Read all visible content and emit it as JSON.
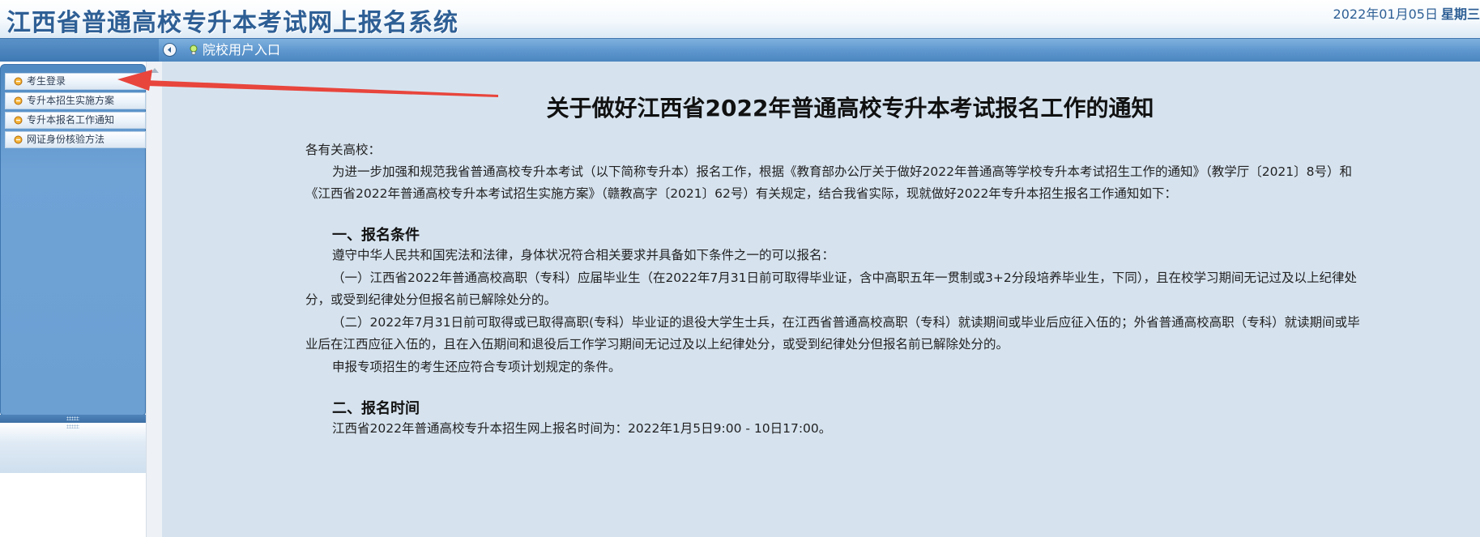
{
  "header": {
    "title": "江西省普通高校专升本考试网上报名系统",
    "date": "2022年01月05日",
    "weekday": "星期三"
  },
  "navbar": {
    "collapse_icon": "chevron-left-icon",
    "link_label": "院校用户入口",
    "link_icon": "bulb-icon"
  },
  "sidebar": {
    "items": [
      {
        "label": "考生登录",
        "icon": "bulb-icon"
      },
      {
        "label": "专升本招生实施方案",
        "icon": "bulb-icon"
      },
      {
        "label": "专升本报名工作通知",
        "icon": "bulb-icon"
      },
      {
        "label": "网证身份核验方法",
        "icon": "bulb-icon"
      }
    ]
  },
  "notice": {
    "title": "关于做好江西省2022年普通高校专升本考试报名工作的通知",
    "salutation": "各有关高校：",
    "intro_line1": "为进一步加强和规范我省普通高校专升本考试（以下简称专升本）报名工作，根据《教育部办公厅关于做好2022年普通高等学校专升本考试招生工作的通知》（教学厅〔2021〕8号）和",
    "intro_line2": "《江西省2022年普通高校专升本考试招生实施方案》（赣教高字〔2021〕62号）有关规定，结合我省实际，现就做好2022年专升本招生报名工作通知如下：",
    "section1": {
      "heading": "一、报名条件",
      "line1": "遵守中华人民共和国宪法和法律，身体状况符合相关要求并具备如下条件之一的可以报名：",
      "line2": "（一）江西省2022年普通高校高职（专科）应届毕业生（在2022年7月31日前可取得毕业证，含中高职五年一贯制或3+2分段培养毕业生，下同），且在校学习期间无记过及以上纪律处",
      "line3": "分，或受到纪律处分但报名前已解除处分的。",
      "line4": "（二）2022年7月31日前可取得或已取得高职(专科）毕业证的退役大学生士兵，在江西省普通高校高职（专科）就读期间或毕业后应征入伍的；外省普通高校高职（专科）就读期间或毕",
      "line5": "业后在江西应征入伍的，且在入伍期间和退役后工作学习期间无记过及以上纪律处分，或受到纪律处分但报名前已解除处分的。",
      "line6": "申报专项招生的考生还应符合专项计划规定的条件。"
    },
    "section2": {
      "heading": "二、报名时间",
      "line1": "江西省2022年普通高校专升本招生网上报名时间为：2022年1月5日9:00 - 10日17:00。"
    }
  },
  "colors": {
    "brand_blue": "#2e5f95",
    "nav_blue": "#5f98cf",
    "content_bg": "#d6e3ef",
    "annotation_red": "#e8453c"
  }
}
